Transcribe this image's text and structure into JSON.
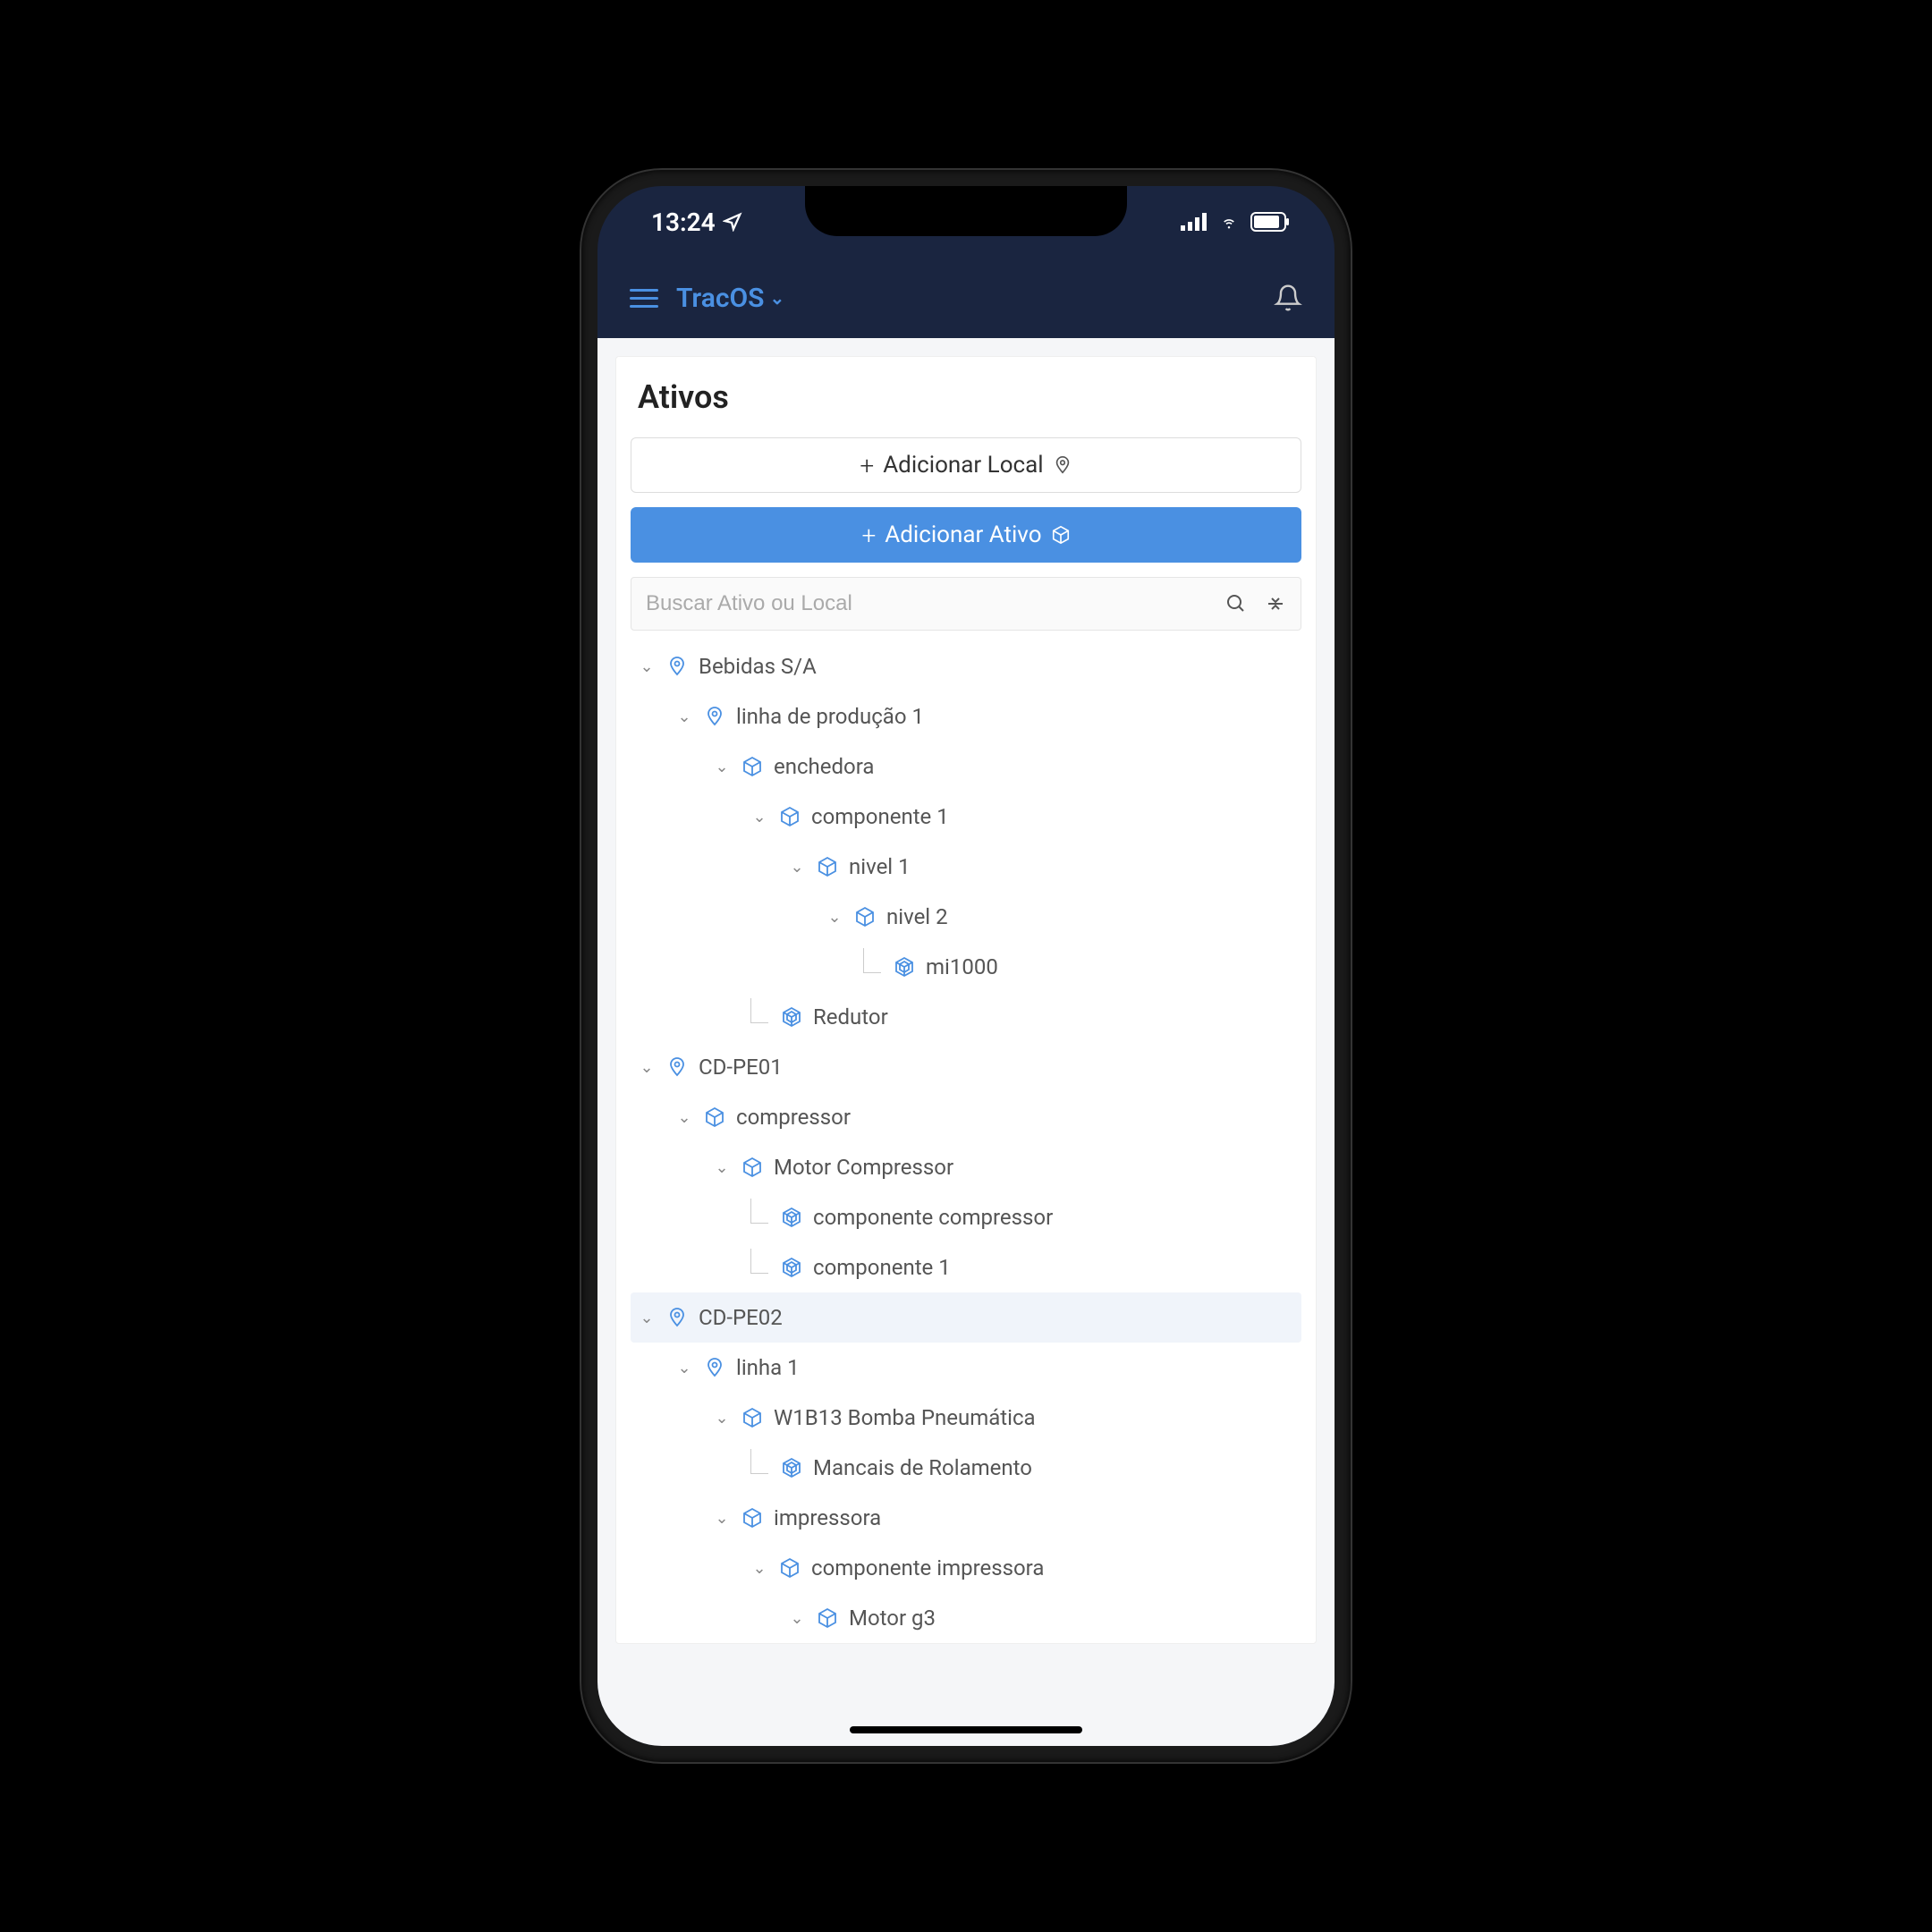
{
  "status": {
    "time": "13:24"
  },
  "header": {
    "app_name": "TracOS"
  },
  "page": {
    "title": "Ativos",
    "add_location_label": "Adicionar Local",
    "add_asset_label": "Adicionar Ativo",
    "search_placeholder": "Buscar Ativo ou Local"
  },
  "tree": [
    {
      "depth": 0,
      "type": "location",
      "expand": "open",
      "label": "Bebidas S/A"
    },
    {
      "depth": 1,
      "type": "location",
      "expand": "open",
      "label": "linha de produção 1"
    },
    {
      "depth": 2,
      "type": "asset",
      "expand": "open",
      "label": "enchedora"
    },
    {
      "depth": 3,
      "type": "asset",
      "expand": "open",
      "label": "componente 1"
    },
    {
      "depth": 4,
      "type": "asset",
      "expand": "open",
      "label": "nivel 1"
    },
    {
      "depth": 5,
      "type": "asset",
      "expand": "open",
      "label": "nivel 2"
    },
    {
      "depth": 6,
      "type": "sensor",
      "expand": "leaf",
      "label": "mi1000",
      "elbow": true
    },
    {
      "depth": 3,
      "type": "sensor",
      "expand": "leaf",
      "label": "Redutor",
      "elbow": true
    },
    {
      "depth": 0,
      "type": "location",
      "expand": "open",
      "label": "CD-PE01"
    },
    {
      "depth": 1,
      "type": "asset",
      "expand": "open",
      "label": "compressor"
    },
    {
      "depth": 2,
      "type": "asset",
      "expand": "open",
      "label": "Motor Compressor"
    },
    {
      "depth": 3,
      "type": "sensor",
      "expand": "leaf",
      "label": "componente compressor",
      "elbow": true
    },
    {
      "depth": 3,
      "type": "sensor",
      "expand": "leaf",
      "label": "componente 1",
      "elbow": true
    },
    {
      "depth": 0,
      "type": "location",
      "expand": "open",
      "label": "CD-PE02",
      "selected": true
    },
    {
      "depth": 1,
      "type": "location",
      "expand": "open",
      "label": "linha 1"
    },
    {
      "depth": 2,
      "type": "asset",
      "expand": "open",
      "label": "W1B13 Bomba Pneumática"
    },
    {
      "depth": 3,
      "type": "sensor",
      "expand": "leaf",
      "label": "Mancais de Rolamento",
      "elbow": true
    },
    {
      "depth": 2,
      "type": "asset",
      "expand": "open",
      "label": "impressora"
    },
    {
      "depth": 3,
      "type": "asset",
      "expand": "open",
      "label": "componente impressora"
    },
    {
      "depth": 4,
      "type": "asset",
      "expand": "open",
      "label": "Motor g3"
    }
  ],
  "icons": {
    "location": "pin-icon",
    "asset": "box-icon",
    "sensor": "diamond-icon"
  },
  "colors": {
    "primary": "#4a90e2",
    "header_bg": "#1a2540"
  }
}
